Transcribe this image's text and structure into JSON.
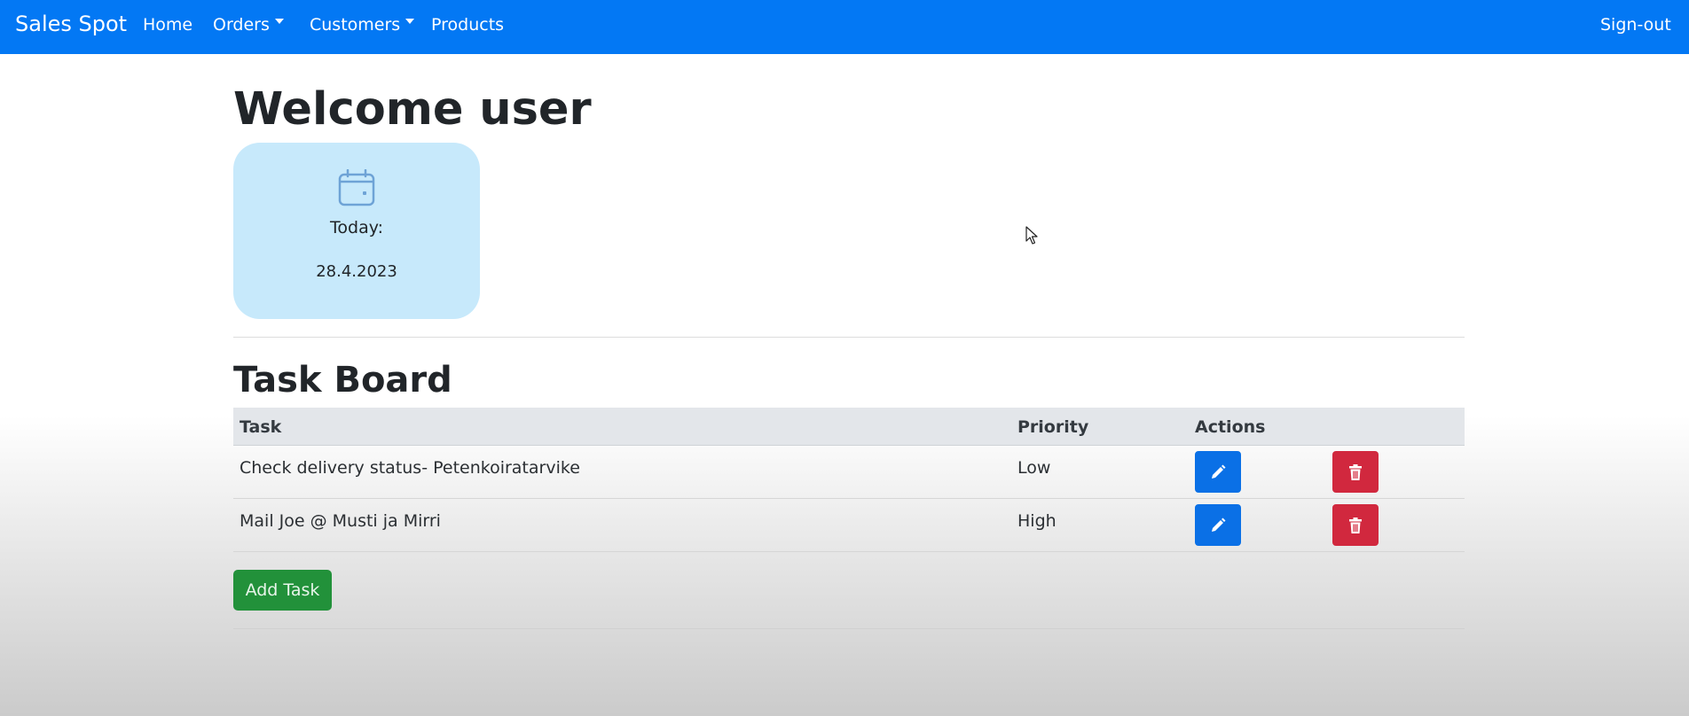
{
  "navbar": {
    "brand": "Sales Spot",
    "items": [
      {
        "label": "Home",
        "dropdown": false
      },
      {
        "label": "Orders",
        "dropdown": true
      },
      {
        "label": "Customers",
        "dropdown": true
      },
      {
        "label": "Products",
        "dropdown": false
      }
    ],
    "signout": "Sign-out"
  },
  "welcome": {
    "title": "Welcome user"
  },
  "today_card": {
    "icon": "calendar-icon",
    "label": "Today:",
    "date": "28.4.2023"
  },
  "task_board": {
    "title": "Task Board",
    "columns": [
      "Task",
      "Priority",
      "Actions"
    ],
    "rows": [
      {
        "task": "Check delivery status- Petenkoiratarvike",
        "priority": "Low"
      },
      {
        "task": "Mail Joe @ Musti ja Mirri",
        "priority": "High"
      }
    ],
    "add_button": "Add Task"
  },
  "colors": {
    "navbar": "#0378f4",
    "today_card": "#c7e9fb",
    "edit_button": "#0a70e6",
    "delete_button": "#d1283e",
    "add_button": "#22913a"
  },
  "icons": {
    "edit": "pencil-icon",
    "delete": "trash-icon"
  }
}
